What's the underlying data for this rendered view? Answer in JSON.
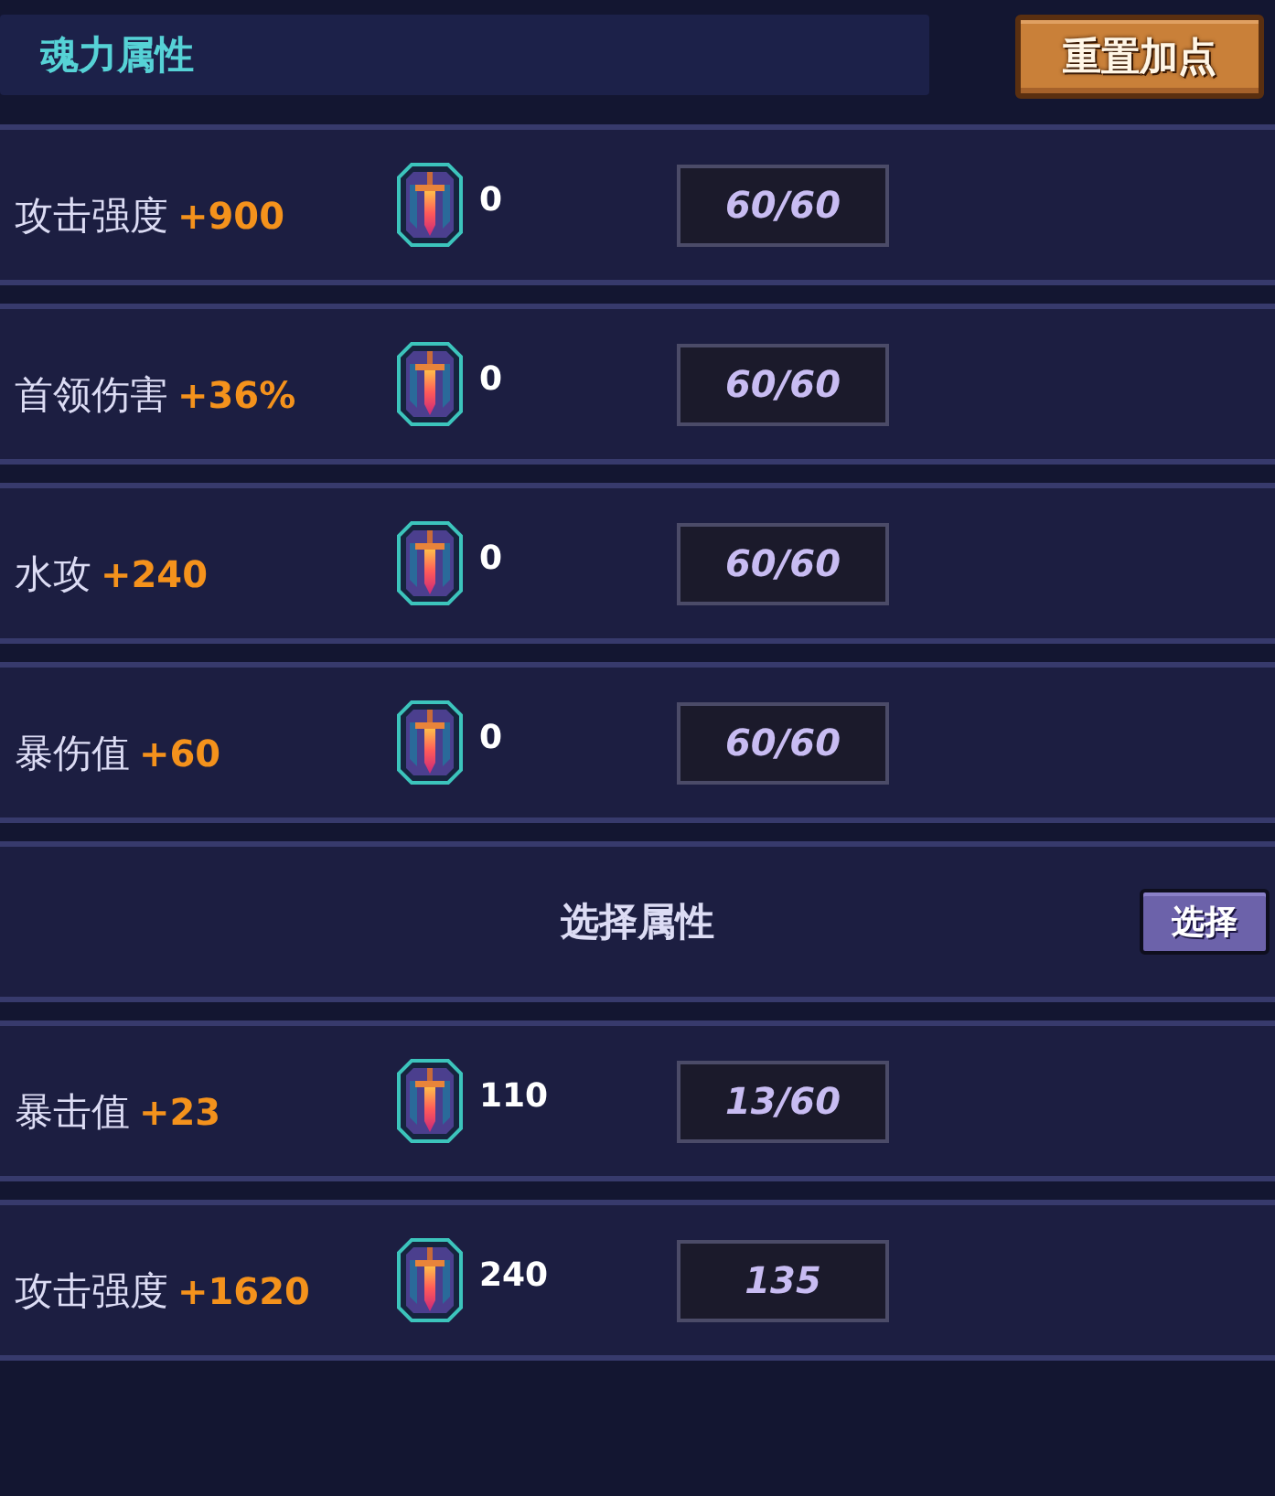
{
  "header": {
    "title": "魂力属性",
    "reset_button": "重置加点"
  },
  "rows": [
    {
      "kind": "stat",
      "name": "攻击强度",
      "bonus": "+900",
      "count": "0",
      "value": "60/60"
    },
    {
      "kind": "stat",
      "name": "首领伤害",
      "bonus": "+36%",
      "count": "0",
      "value": "60/60"
    },
    {
      "kind": "stat",
      "name": "水攻",
      "bonus": "+240",
      "count": "0",
      "value": "60/60"
    },
    {
      "kind": "stat",
      "name": "暴伤值",
      "bonus": "+60",
      "count": "0",
      "value": "60/60"
    },
    {
      "kind": "select",
      "label": "选择属性",
      "button": "选择"
    },
    {
      "kind": "stat",
      "name": "暴击值",
      "bonus": "+23",
      "count": "110",
      "value": "13/60"
    },
    {
      "kind": "stat",
      "name": "攻击强度",
      "bonus": "+1620",
      "count": "240",
      "value": "135"
    }
  ]
}
